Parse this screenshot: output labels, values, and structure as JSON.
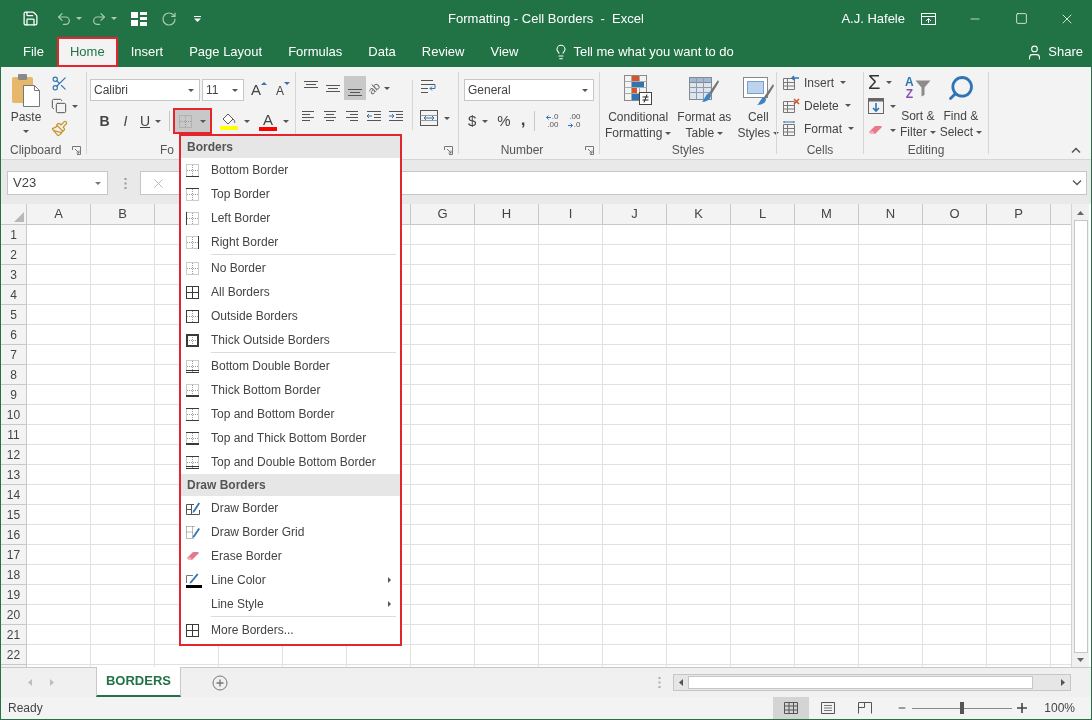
{
  "window": {
    "title": "Formatting - Cell Borders  -  Excel",
    "user": "A.J. Hafele"
  },
  "ribbon_tabs": [
    {
      "label": "File",
      "selected": false,
      "outlined": false
    },
    {
      "label": "Home",
      "selected": true,
      "outlined": true
    },
    {
      "label": "Insert",
      "selected": false,
      "outlined": false
    },
    {
      "label": "Page Layout",
      "selected": false,
      "outlined": false
    },
    {
      "label": "Formulas",
      "selected": false,
      "outlined": false
    },
    {
      "label": "Data",
      "selected": false,
      "outlined": false
    },
    {
      "label": "Review",
      "selected": false,
      "outlined": false
    },
    {
      "label": "View",
      "selected": false,
      "outlined": false
    }
  ],
  "tell_me": {
    "placeholder": "Tell me what you want to do"
  },
  "share": {
    "label": "Share"
  },
  "clipboard": {
    "paste": "Paste",
    "label": "Clipboard"
  },
  "font": {
    "font_name": "Calibri",
    "font_size": "11",
    "grow_glyph": "A",
    "shrink_glyph": "A",
    "bold": "B",
    "italic": "I",
    "underline": "U",
    "color_glyph": "A",
    "label": "Fo",
    "borders_button": {
      "outlined": true,
      "expanded": true
    }
  },
  "alignment": {
    "vertical": [
      {
        "selected": false
      },
      {
        "selected": false
      },
      {
        "selected": true
      }
    ],
    "orientation_glyph": "ab"
  },
  "number": {
    "format": "General",
    "currency": "$",
    "percent": "%",
    "comma": ",",
    "increase_decimal": [
      ".0",
      ".00"
    ],
    "decrease_decimal": [
      ".00",
      ".0"
    ],
    "label": "Number"
  },
  "styles": {
    "buttons": [
      {
        "lines": [
          "Conditional",
          "Formatting"
        ]
      },
      {
        "lines": [
          "Format as",
          "Table"
        ]
      },
      {
        "lines": [
          "Cell",
          "Styles"
        ]
      }
    ],
    "label": "Styles"
  },
  "cells": {
    "buttons": [
      "Insert",
      "Delete",
      "Format"
    ],
    "label": "Cells"
  },
  "editing": {
    "autosum_glyph": "Σ",
    "sort_glyphs": [
      "A",
      "Z"
    ],
    "buttons": [
      {
        "lines": [
          "Sort &",
          "Filter"
        ]
      },
      {
        "lines": [
          "Find &",
          "Select"
        ]
      }
    ],
    "label": "Editing"
  },
  "formula_bar": {
    "name_box": "V23"
  },
  "sheet": {
    "columns_left": [
      "A",
      "B"
    ],
    "columns_right": [
      "G",
      "H",
      "I",
      "J",
      "K",
      "L",
      "M",
      "N",
      "O",
      "P"
    ],
    "rows": [
      "1",
      "2",
      "3",
      "4",
      "5",
      "6",
      "7",
      "8",
      "9",
      "10",
      "11",
      "12",
      "13",
      "14",
      "15",
      "16",
      "17",
      "18",
      "19",
      "20",
      "21",
      "22"
    ]
  },
  "borders_menu": {
    "outlined": true,
    "sections": [
      {
        "title": "Borders",
        "groups": [
          [
            {
              "label": "Bottom Border",
              "submenu": false
            },
            {
              "label": "Top Border",
              "submenu": false
            },
            {
              "label": "Left Border",
              "submenu": false
            },
            {
              "label": "Right Border",
              "submenu": false
            }
          ],
          [
            {
              "label": "No Border",
              "submenu": false
            },
            {
              "label": "All Borders",
              "submenu": false
            },
            {
              "label": "Outside Borders",
              "submenu": false
            },
            {
              "label": "Thick Outside Borders",
              "submenu": false
            }
          ],
          [
            {
              "label": "Bottom Double Border",
              "submenu": false
            },
            {
              "label": "Thick Bottom Border",
              "submenu": false
            },
            {
              "label": "Top and Bottom Border",
              "submenu": false
            },
            {
              "label": "Top and Thick Bottom Border",
              "submenu": false
            },
            {
              "label": "Top and Double Bottom Border",
              "submenu": false
            }
          ]
        ]
      },
      {
        "title": "Draw Borders",
        "groups": [
          [
            {
              "label": "Draw Border",
              "submenu": false
            },
            {
              "label": "Draw Border Grid",
              "submenu": false
            },
            {
              "label": "Erase Border",
              "submenu": false
            },
            {
              "label": "Line Color",
              "submenu": true
            },
            {
              "label": "Line Style",
              "submenu": true
            }
          ],
          [
            {
              "label": "More Borders...",
              "submenu": false
            }
          ]
        ]
      }
    ]
  },
  "sheet_tabs": [
    {
      "label": "BORDERS",
      "selected": true
    }
  ],
  "status_bar": {
    "status": "Ready",
    "views": [
      {
        "selected": true
      },
      {
        "selected": false
      },
      {
        "selected": false
      }
    ],
    "zoom": {
      "level": 0.5,
      "reading": "100%"
    }
  }
}
